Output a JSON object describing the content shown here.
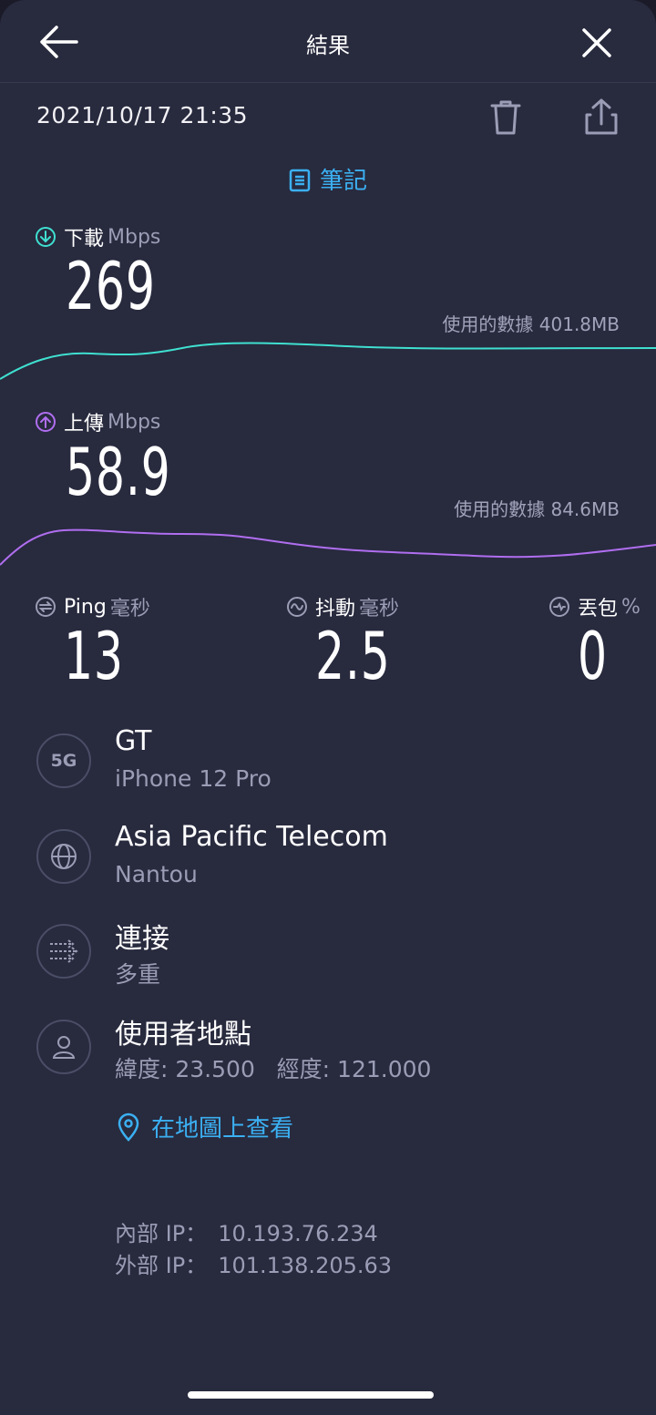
{
  "header": {
    "title": "結果"
  },
  "result": {
    "datetime": "2021/10/17 21:35"
  },
  "notes_label": "筆記",
  "download": {
    "label": "下載",
    "unit": "Mbps",
    "value": "269",
    "data_used_label": "使用的數據",
    "data_used": "401.8MB",
    "color": "#3fe0d0"
  },
  "upload": {
    "label": "上傳",
    "unit": "Mbps",
    "value": "58.9",
    "data_used_label": "使用的數據",
    "data_used": "84.6MB",
    "color": "#b06ef0"
  },
  "ping": {
    "label": "Ping",
    "unit": "毫秒",
    "value": "13"
  },
  "jitter": {
    "label": "抖動",
    "unit": "毫秒",
    "value": "2.5"
  },
  "loss": {
    "label": "丟包",
    "unit": "%",
    "value": "0"
  },
  "details": [
    {
      "icon": "5G",
      "title": "GT",
      "subtitle": "iPhone 12 Pro"
    },
    {
      "icon": "globe-icon",
      "title": "Asia Pacific Telecom",
      "subtitle": "Nantou"
    },
    {
      "icon": "connections-icon",
      "title": "連接",
      "subtitle": "多重"
    },
    {
      "icon": "user-icon",
      "title": "使用者地點",
      "subtitle": "緯度: 23.500   經度: 121.000"
    }
  ],
  "map_link": "在地圖上查看",
  "ip": {
    "internal_label": "內部 IP：",
    "internal": "10.193.76.234",
    "external_label": "外部 IP：",
    "external": "101.138.205.63"
  },
  "accent": "#3bb0f2"
}
